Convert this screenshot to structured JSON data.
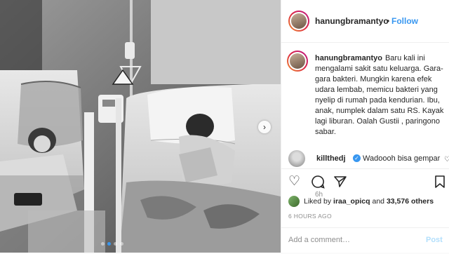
{
  "header": {
    "username": "hanungbramantyo",
    "separator": "•",
    "follow_label": "Follow"
  },
  "caption": {
    "username": "hanungbramantyo",
    "text": "Baru kali ini mengalami sakit satu keluarga. Gara-gara bakteri. Mungkin karena efek udara lembab, memicu bakteri yang nyelip di rumah pada kendurian. Ibu, anak, numplek dalam satu RS. Kayak lagi liburan. Oalah Gustii , paringono sabar.",
    "time": "6h"
  },
  "comment": {
    "username": "killthedj",
    "verified": true,
    "text": "Wadoooh bisa gempar"
  },
  "actions": {
    "like_icon": "heart-outline-icon",
    "comment_icon": "speech-bubble-icon",
    "share_icon": "paper-plane-icon",
    "save_icon": "bookmark-icon"
  },
  "likes": {
    "prefix": "Liked by",
    "liker": "iraa_opicq",
    "conjunction": "and",
    "count": "33,576 others"
  },
  "posted_ago": "6 HOURS AGO",
  "add_comment": {
    "placeholder": "Add a comment…",
    "post_label": "Post"
  },
  "carousel": {
    "slide_count": 4,
    "active_index": 1
  },
  "colors": {
    "accent": "#3897f0",
    "text": "#262626",
    "muted": "#8e8e8e",
    "border": "#efefef"
  }
}
